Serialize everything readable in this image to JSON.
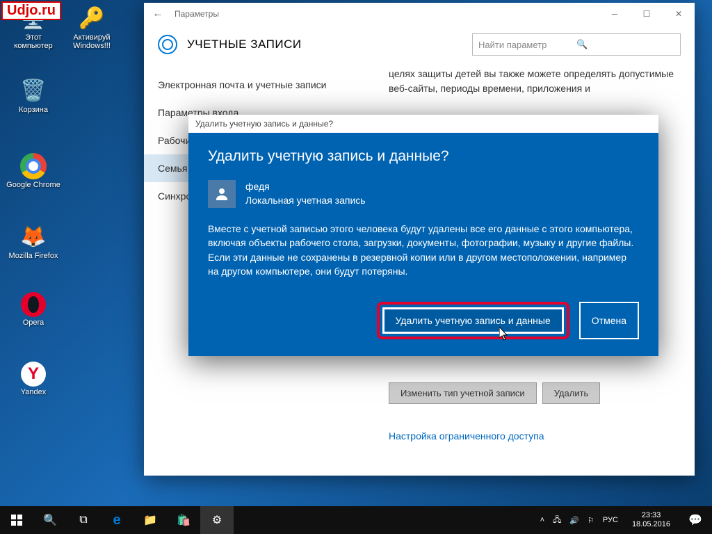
{
  "watermark": "Udjo.ru",
  "desktop_icons": [
    {
      "label": "Этот\nкомпьютер",
      "name": "this-pc"
    },
    {
      "label": "Активируй\nWindows!!!",
      "name": "activate-windows"
    },
    {
      "label": "Корзина",
      "name": "recycle-bin"
    },
    {
      "label": "Google\nChrome",
      "name": "chrome"
    },
    {
      "label": "Mozilla\nFirefox",
      "name": "firefox"
    },
    {
      "label": "Opera",
      "name": "opera"
    },
    {
      "label": "Yandex",
      "name": "yandex"
    }
  ],
  "settings": {
    "window_title": "Параметры",
    "page_heading": "УЧЕТНЫЕ ЗАПИСИ",
    "search_placeholder": "Найти параметр",
    "sidebar": [
      "Электронная почта и учетные записи",
      "Параметры входа",
      "Рабочий доступ",
      "Семья и другие пользователи",
      "Синхронизация ваших параметров"
    ],
    "main_text": "целях защиты детей вы также можете определять допустимые веб-сайты, периоды времени, приложения и",
    "change_btn": "Изменить тип учетной записи",
    "delete_btn": "Удалить",
    "link": "Настройка ограниченного доступа"
  },
  "dialog": {
    "titlebar": "Удалить учетную запись и данные?",
    "heading": "Удалить учетную запись и данные?",
    "account_name": "федя",
    "account_type": "Локальная учетная запись",
    "body": "Вместе с учетной записью этого человека будут удалены все его данные с этого компьютера, включая объекты рабочего стола, загрузки, документы, фотографии, музыку и другие файлы. Если эти данные не сохранены в резервной копии или в другом местоположении, например на другом компьютере, они будут потеряны.",
    "confirm": "Удалить учетную запись и данные",
    "cancel": "Отмена"
  },
  "taskbar": {
    "lang": "РУС",
    "time": "23:33",
    "date": "18.05.2016"
  }
}
